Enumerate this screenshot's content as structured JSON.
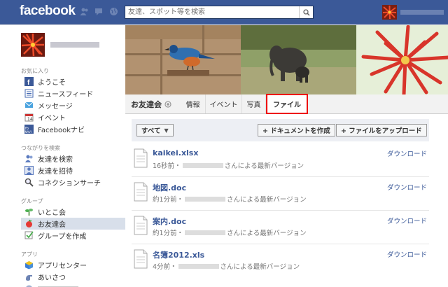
{
  "topbar": {
    "logo": "facebook",
    "search": {
      "placeholder": "友達、スポット等を検索"
    }
  },
  "sidebar": {
    "favorites_head": "お気に入り",
    "favorites": [
      {
        "label": "ようこそ"
      },
      {
        "label": "ニュースフィード"
      },
      {
        "label": "メッセージ"
      },
      {
        "label": "イベント"
      },
      {
        "label": "Facebookナビ"
      }
    ],
    "connect_head": "つながりを検索",
    "connect": [
      {
        "label": "友達を検索"
      },
      {
        "label": "友達を招待"
      },
      {
        "label": "コネクションサーチ"
      }
    ],
    "groups_head": "グループ",
    "groups": [
      {
        "label": "いとこ会"
      },
      {
        "label": "お友達会"
      },
      {
        "label": "グループを作成"
      }
    ],
    "apps_head": "アプリ",
    "apps": [
      {
        "label": "アプリセンター"
      },
      {
        "label": "あいさつ"
      }
    ]
  },
  "group": {
    "name": "お友達会",
    "tabs": [
      {
        "label": "情報"
      },
      {
        "label": "イベント"
      },
      {
        "label": "写真"
      },
      {
        "label": "ファイル"
      }
    ]
  },
  "toolbar": {
    "filter": "すべて",
    "create_doc": "+ ドキュメントを作成",
    "upload": "+ ファイルをアップロード"
  },
  "files": [
    {
      "name": "kaikei.xlsx",
      "time": "16秒前・",
      "suffix": "さんによる最新バージョン",
      "download": "ダウンロード"
    },
    {
      "name": "地図.doc",
      "time": "約1分前・",
      "suffix": "さんによる最新バージョン",
      "download": "ダウンロード"
    },
    {
      "name": "案内.doc",
      "time": "約1分前・",
      "suffix": "さんによる最新バージョン",
      "download": "ダウンロード"
    },
    {
      "name": "名簿2012.xls",
      "time": "4分前・",
      "suffix": "さんによる最新バージョン",
      "download": "ダウンロード"
    }
  ],
  "colors": {
    "brand": "#3b5998",
    "highlight": "#e00000",
    "active_nav": "#d8dfea"
  }
}
